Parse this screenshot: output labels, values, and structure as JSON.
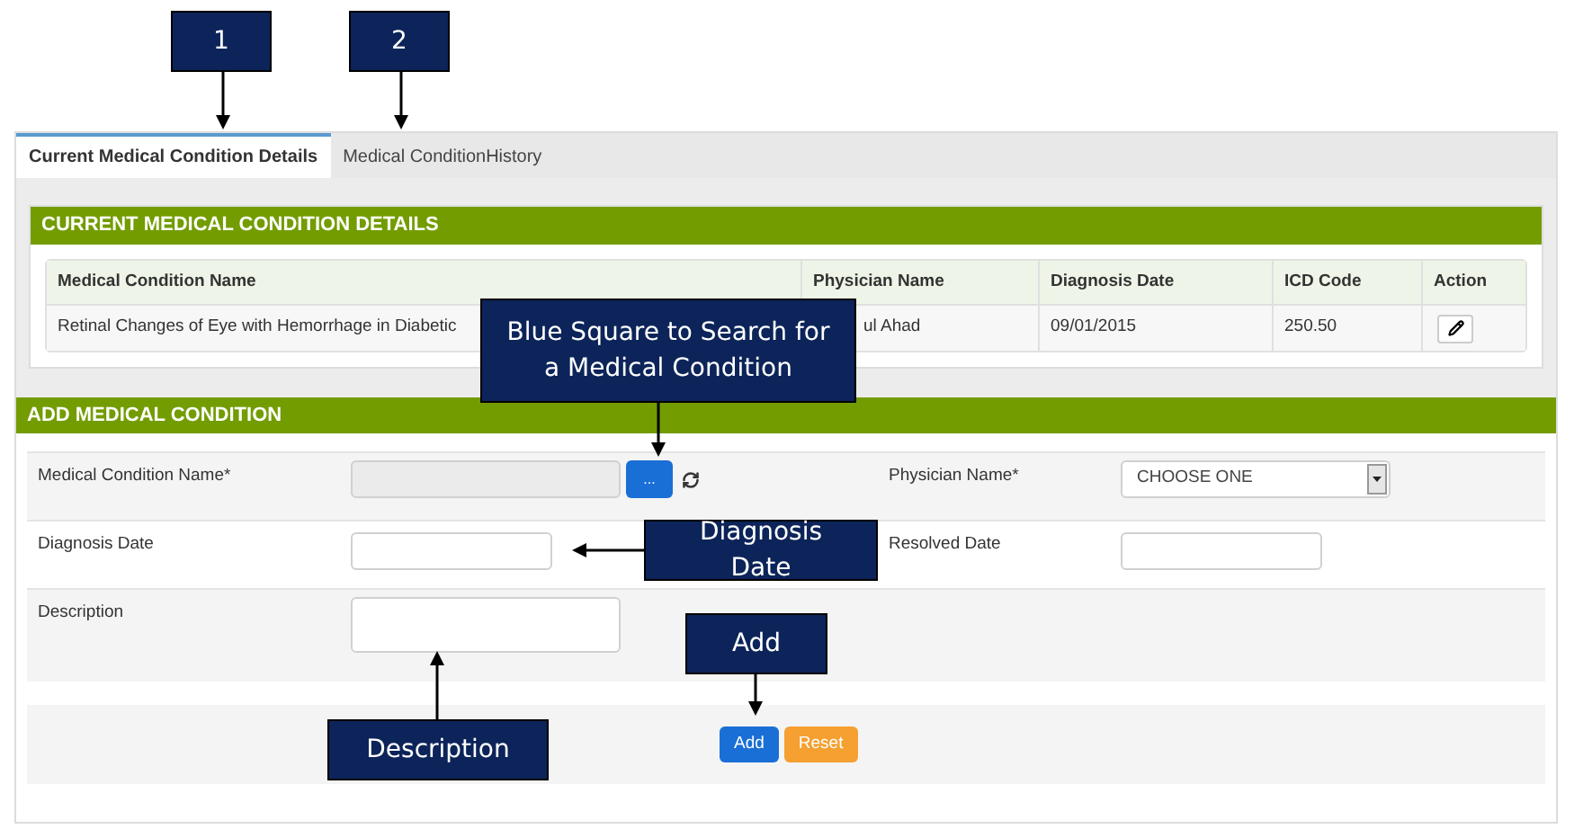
{
  "tabs": [
    {
      "label": "Current Medical Condition Details",
      "selected": true
    },
    {
      "label": "Medical ConditionHistory",
      "selected": false
    }
  ],
  "current_section": {
    "title": "CURRENT MEDICAL CONDITION DETAILS",
    "table": {
      "columns": [
        "Medical Condition Name",
        "Physician Name",
        "Diagnosis Date",
        "ICD Code",
        "Action"
      ],
      "rows": [
        {
          "name": "Retinal Changes of Eye with Hemorrhage in Diabetic",
          "physician": "ul Ahad",
          "diagnosis_date": "09/01/2015",
          "icd_code": "250.50"
        }
      ]
    }
  },
  "add_section": {
    "title": "ADD MEDICAL CONDITION",
    "rows": [
      {
        "left": {
          "label": "Medical Condition Name*",
          "kind": "lookup",
          "button": "..."
        },
        "right": {
          "label": "Physician Name*",
          "kind": "select",
          "value": "CHOOSE ONE"
        }
      },
      {
        "left": {
          "label": "Diagnosis Date",
          "kind": "date"
        },
        "right": {
          "label": "Resolved Date",
          "kind": "date"
        }
      },
      {
        "left": {
          "label": "Description",
          "kind": "textarea"
        }
      }
    ],
    "buttons": [
      {
        "label": "Add",
        "kind": "primary"
      },
      {
        "label": "Reset",
        "kind": "warning"
      }
    ]
  },
  "callouts": [
    {
      "text": "1"
    },
    {
      "text": "2"
    },
    {
      "text": "Blue Square to Search for a Medical Condition"
    },
    {
      "text": "Diagnosis Date"
    },
    {
      "text": "Add"
    },
    {
      "text": "Description"
    }
  ]
}
